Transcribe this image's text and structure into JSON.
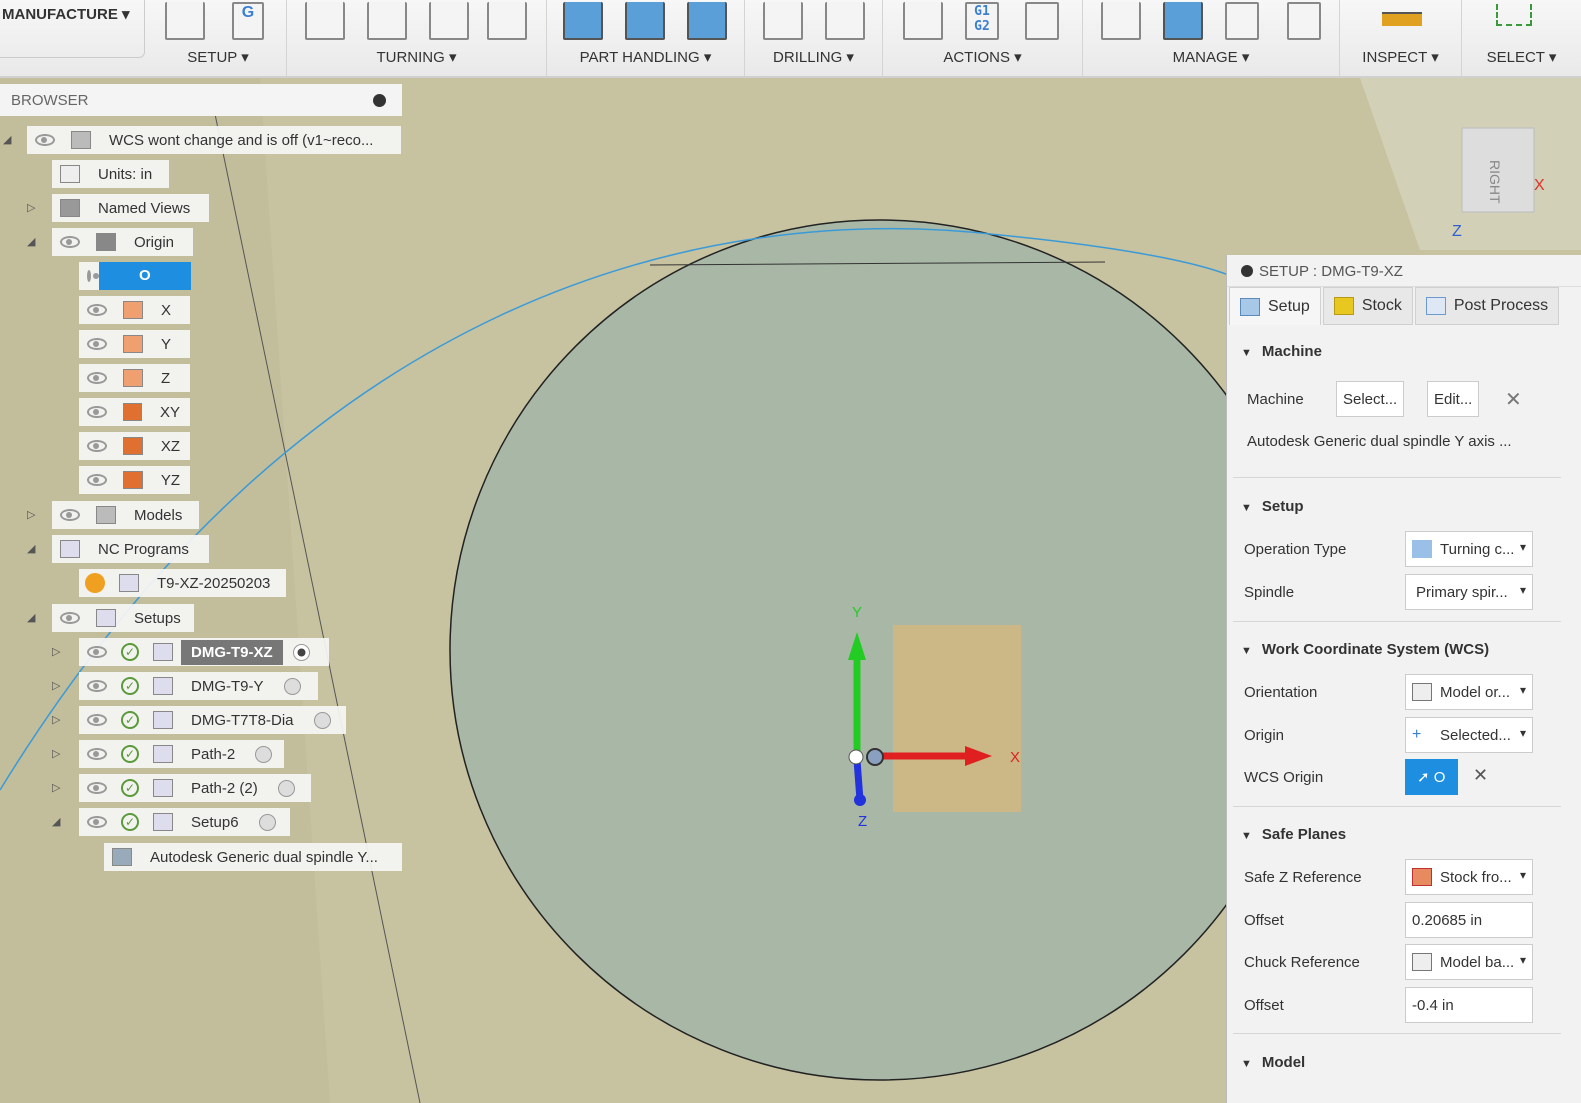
{
  "toolbar": {
    "workspace": "MANUFACTURE",
    "groups": [
      "SETUP ▾",
      "TURNING ▾",
      "PART HANDLING ▾",
      "DRILLING ▾",
      "ACTIONS ▾",
      "MANAGE ▾",
      "INSPECT ▾",
      "SELECT ▾"
    ],
    "g1g2": "G1\nG2"
  },
  "browser": {
    "title": "BROWSER",
    "items": [
      {
        "label": "WCS wont change and is off (v1~reco..."
      },
      {
        "label": "Units: in"
      },
      {
        "label": "Named Views"
      },
      {
        "label": "Origin"
      },
      {
        "label": "O"
      },
      {
        "label": "X"
      },
      {
        "label": "Y"
      },
      {
        "label": "Z"
      },
      {
        "label": "XY"
      },
      {
        "label": "XZ"
      },
      {
        "label": "YZ"
      },
      {
        "label": "Models"
      },
      {
        "label": "NC Programs"
      },
      {
        "label": "T9-XZ-20250203"
      },
      {
        "label": "Setups"
      },
      {
        "label": "DMG-T9-XZ"
      },
      {
        "label": "DMG-T9-Y"
      },
      {
        "label": "DMG-T7T8-Dia"
      },
      {
        "label": "Path-2"
      },
      {
        "label": "Path-2 (2)"
      },
      {
        "label": "Setup6"
      },
      {
        "label": "Autodesk Generic dual spindle Y..."
      }
    ]
  },
  "viewport": {
    "axis_x": "X",
    "axis_y": "Y",
    "axis_z": "Z",
    "viewcube_face": "RIGHT"
  },
  "panel": {
    "title": "SETUP : DMG-T9-XZ",
    "tabs": [
      "Setup",
      "Stock",
      "Post Process"
    ],
    "machine": {
      "section": "Machine",
      "label": "Machine",
      "select": "Select...",
      "edit": "Edit...",
      "name": "Autodesk Generic dual spindle Y axis ..."
    },
    "setup": {
      "section": "Setup",
      "op_type_label": "Operation Type",
      "op_type": "Turning c...",
      "spindle_label": "Spindle",
      "spindle": "Primary spir..."
    },
    "wcs": {
      "section": "Work Coordinate System (WCS)",
      "orientation_label": "Orientation",
      "orientation": "Model or...",
      "origin_label": "Origin",
      "origin": "Selected...",
      "wcs_origin_label": "WCS Origin",
      "wcs_origin": "O"
    },
    "safe": {
      "section": "Safe Planes",
      "safe_z_label": "Safe Z Reference",
      "safe_z": "Stock fro...",
      "offset_label": "Offset",
      "offset": "0.20685 in",
      "chuck_label": "Chuck Reference",
      "chuck": "Model ba...",
      "offset2_label": "Offset",
      "offset2": "-0.4 in"
    },
    "model": {
      "section": "Model"
    }
  }
}
